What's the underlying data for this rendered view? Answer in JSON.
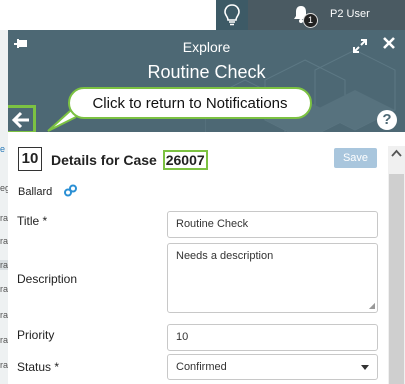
{
  "topbar": {
    "notification_count": "1",
    "user_name": "P2 User"
  },
  "panel": {
    "section_title": "Explore",
    "record_title": "Routine Check",
    "callout": "Click to return to Notifications",
    "help_label": "?"
  },
  "case": {
    "number_box": "10",
    "title_prefix": "Details for Case",
    "case_id": "26007",
    "save_label": "Save",
    "owner": "Ballard"
  },
  "form": {
    "title_label": "Title *",
    "title_value": "Routine Check",
    "description_label": "Description",
    "description_value": "Needs a description",
    "priority_label": "Priority",
    "priority_value": "10",
    "status_label": "Status *",
    "status_value": "Confirmed"
  },
  "background_list": {
    "rows": [
      "e",
      "eg",
      "ra",
      "ra",
      "ra",
      "ra",
      "ra",
      "ra",
      "ra"
    ]
  },
  "colors": {
    "header": "#4d6874",
    "highlight": "#7cc242",
    "save": "#a9c6dd"
  }
}
